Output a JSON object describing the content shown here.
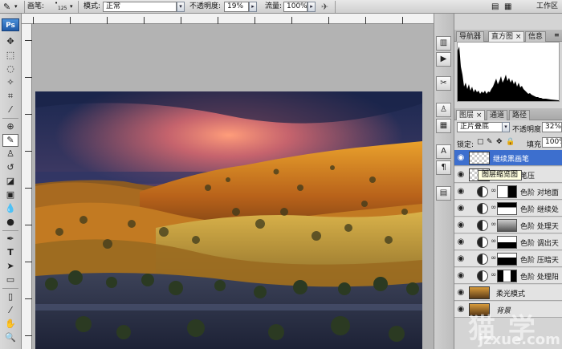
{
  "options_bar": {
    "brush_label": "画笔:",
    "brush_size": "125",
    "mode_label": "模式:",
    "mode_value": "正常",
    "opacity_label": "不透明度:",
    "opacity_value": "19%",
    "flow_label": "流量:",
    "flow_value": "100%",
    "workspace_label": "工作区"
  },
  "toolbox": {
    "logo": "Ps",
    "active_tool": "brush-tool",
    "type_tool_glyph": "T"
  },
  "panels": {
    "top_tabs": [
      "导航器",
      "直方图",
      "信息"
    ],
    "top_active": "直方图",
    "layer_tabs": [
      "图层",
      "通道",
      "路径"
    ],
    "layer_active": "图层",
    "blend_mode": "正片叠底",
    "opacity_label": "不透明度:",
    "opacity_value": "32%",
    "lock_label": "锁定:",
    "fill_label": "填充:",
    "fill_value": "100%",
    "layers": [
      {
        "name": "继续黑画笔",
        "selected": true
      },
      {
        "name": "黑画笔压",
        "selected": false
      },
      {
        "name": "色阶 对地面",
        "selected": false
      },
      {
        "name": "色阶 继续处",
        "selected": false
      },
      {
        "name": "色阶 处理天",
        "selected": false
      },
      {
        "name": "色阶 调出天",
        "selected": false
      },
      {
        "name": "色阶 压暗天",
        "selected": false
      },
      {
        "name": "色阶 处理阳",
        "selected": false
      },
      {
        "name": "柔光模式",
        "selected": false
      },
      {
        "name": "背景",
        "selected": false
      }
    ],
    "tooltip": "图层缩览图"
  },
  "watermark": {
    "main": "猫 学",
    "domain": "jzxue.com"
  }
}
